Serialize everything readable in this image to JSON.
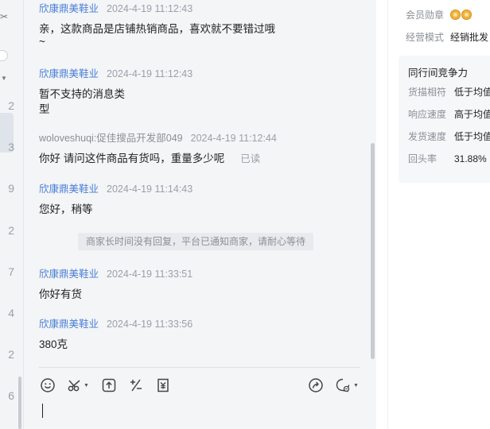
{
  "left_column": {
    "strip_numbers": [
      "2",
      "3",
      "9",
      "2",
      "7",
      "4",
      "2",
      "6"
    ]
  },
  "chat": {
    "messages": [
      {
        "sender": "欣康鼎美鞋业",
        "time": "2024-4-19 11:12:43",
        "lines": [
          "亲，这款商品是店铺热销商品，喜欢就不要错过哦",
          "~"
        ]
      },
      {
        "sender": "欣康鼎美鞋业",
        "time": "2024-4-19 11:12:43",
        "lines": [
          "暂不支持的消息类",
          "型"
        ]
      },
      {
        "sender": "woloveshuqi:促佳搜品开发部049",
        "time": "2024-4-19 11:12:44",
        "lines": [
          "你好 请问这件商品有货吗，重量多少呢"
        ],
        "status": "已读"
      },
      {
        "sender": "欣康鼎美鞋业",
        "time": "2024-4-19 11:14:43",
        "lines": [
          "您好，稍等"
        ]
      },
      {
        "sender": "欣康鼎美鞋业",
        "time": "2024-4-19 11:33:51",
        "lines": [
          "你好有货"
        ]
      },
      {
        "sender": "欣康鼎美鞋业",
        "time": "2024-4-19 11:33:56",
        "lines": [
          "380克"
        ]
      }
    ],
    "system_notice": "商家长时间没有回复，平台已通知商家，请耐心等待"
  },
  "composer": {
    "toolbar_icons": [
      "emoji-icon",
      "scissors-icon",
      "upload-icon",
      "formula-icon",
      "coupon-icon",
      "share-icon",
      "quick-reply-icon"
    ],
    "input_value": ""
  },
  "right_panel": {
    "member_badge_label": "会员勋章",
    "business_mode_label": "经营模式",
    "business_mode_value": "经销批发",
    "competitiveness": {
      "title": "同行间竞争力",
      "rows": [
        {
          "label": "货描相符",
          "value": "低于均值"
        },
        {
          "label": "响应速度",
          "value": "高于均值"
        },
        {
          "label": "发货速度",
          "value": "低于均值"
        },
        {
          "label": "回头率",
          "value": "31.88%"
        }
      ]
    }
  },
  "colors": {
    "accent_blue": "#4a7fd4",
    "chat_bg": "#f4f5f7",
    "medal_gold": "#f0b341"
  }
}
